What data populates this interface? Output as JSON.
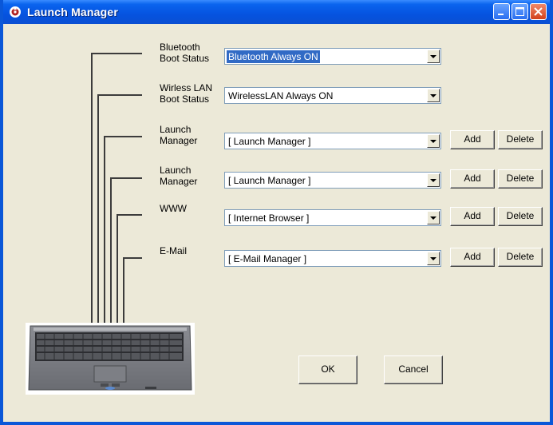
{
  "window": {
    "title": "Launch Manager"
  },
  "rows": [
    {
      "label_line1": "Bluetooth",
      "label_line2": "Boot Status",
      "value": "Bluetooth Always ON",
      "selected": true,
      "has_actions": false
    },
    {
      "label_line1": "Wirless LAN",
      "label_line2": "Boot Status",
      "value": "WirelessLAN Always ON",
      "selected": false,
      "has_actions": false
    },
    {
      "label_line1": "Launch",
      "label_line2": "Manager",
      "value": "[ Launch Manager ]",
      "selected": false,
      "has_actions": true
    },
    {
      "label_line1": "Launch",
      "label_line2": "Manager",
      "value": "[ Launch Manager ]",
      "selected": false,
      "has_actions": true
    },
    {
      "label_line1": "WWW",
      "label_line2": "",
      "value": "[ Internet Browser ]",
      "selected": false,
      "has_actions": true
    },
    {
      "label_line1": "E-Mail",
      "label_line2": "",
      "value": "[ E-Mail Manager ]",
      "selected": false,
      "has_actions": true
    }
  ],
  "actions": {
    "add_label": "Add",
    "delete_label": "Delete"
  },
  "footer": {
    "ok_label": "OK",
    "cancel_label": "Cancel"
  },
  "icons": {
    "app": "launch-manager-icon",
    "laptop": "laptop-image"
  },
  "colors": {
    "titlebar": "#0a57d8",
    "dialog_bg": "#ece9d8",
    "selection": "#316ac5"
  }
}
